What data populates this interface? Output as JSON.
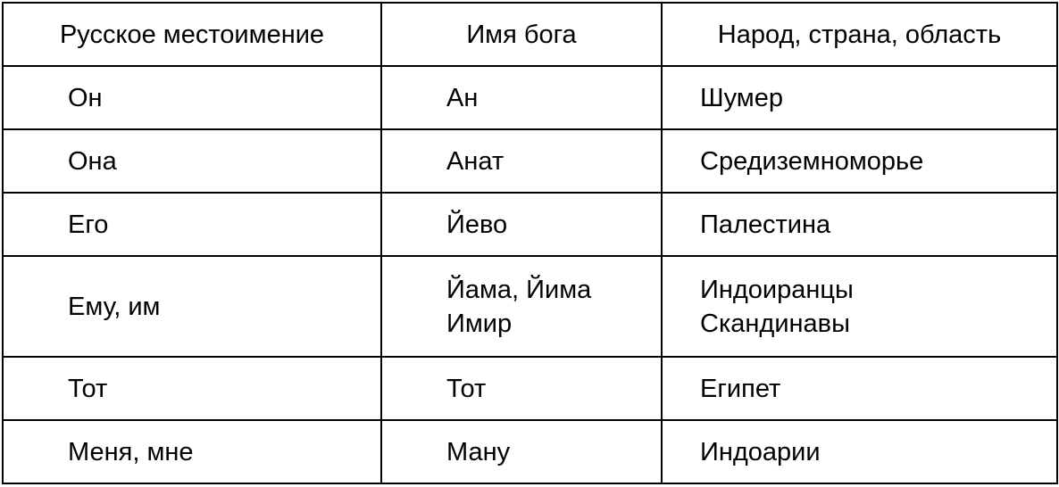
{
  "table": {
    "headers": [
      "Русское местоимение",
      "Имя бога",
      "Народ, страна, область"
    ],
    "rows": [
      {
        "pronoun": [
          "Он"
        ],
        "god": [
          "Ан"
        ],
        "region": [
          "Шумер"
        ]
      },
      {
        "pronoun": [
          "Она"
        ],
        "god": [
          "Анат"
        ],
        "region": [
          "Средиземноморье"
        ]
      },
      {
        "pronoun": [
          "Его"
        ],
        "god": [
          "Йево"
        ],
        "region": [
          "Палестина"
        ]
      },
      {
        "pronoun": [
          "Ему, им"
        ],
        "god": [
          "Йама, Йима",
          "Имир"
        ],
        "region": [
          "Индоиранцы",
          "Скандинавы"
        ]
      },
      {
        "pronoun": [
          "Тот"
        ],
        "god": [
          "Тот"
        ],
        "region": [
          "Египет"
        ]
      },
      {
        "pronoun": [
          "Меня, мне"
        ],
        "god": [
          "Ману"
        ],
        "region": [
          "Индоарии"
        ]
      }
    ]
  }
}
